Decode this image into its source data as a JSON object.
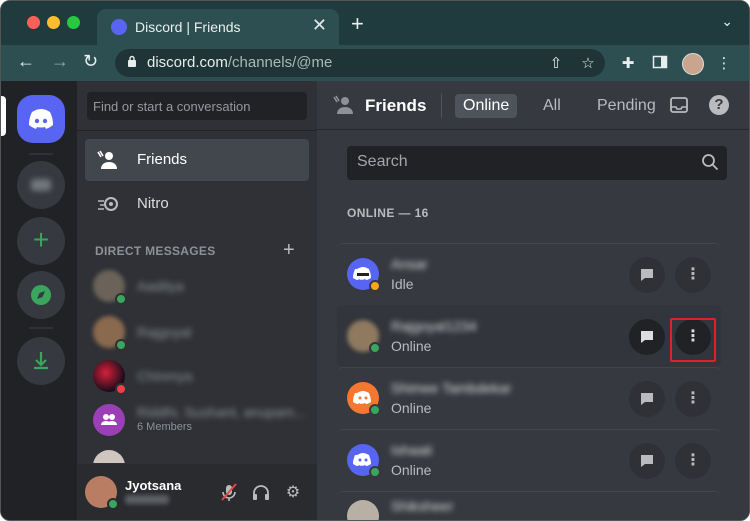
{
  "browser": {
    "tab_title": "Discord | Friends",
    "tab_close": "✕",
    "new_tab": "+",
    "url_host": "discord.com",
    "url_path": "/channels/@me",
    "menu": "⋮"
  },
  "rail": {
    "home_label": "Discord Home",
    "add_server": "+",
    "colors": {
      "accent": "#5865f2",
      "green": "#3ba55d"
    }
  },
  "sidebar": {
    "search_placeholder": "Find or start a conversation",
    "friends_label": "Friends",
    "nitro_label": "Nitro",
    "dm_header": "DIRECT MESSAGES",
    "dm_add": "+",
    "dms": [
      {
        "name": "Aaditya",
        "sub": ""
      },
      {
        "name": "Rajgoyal",
        "sub": ""
      },
      {
        "name": "Chinmya",
        "sub": ""
      },
      {
        "name": "Riddhi, Sushant, anupam...",
        "sub": "6 Members"
      },
      {
        "name": "",
        "sub": ""
      }
    ],
    "user": {
      "name": "Jyotsana"
    }
  },
  "main": {
    "title": "Friends",
    "tabs": [
      "Online",
      "All",
      "Pending"
    ],
    "search_placeholder": "Search",
    "online_header": "ONLINE — 16",
    "friends": [
      {
        "name": "Ansar",
        "status": "Idle"
      },
      {
        "name": "Rajgoyal1234",
        "status": "Online"
      },
      {
        "name": "Shimee Tambdekar",
        "status": "Online"
      },
      {
        "name": "Ishaati",
        "status": "Online"
      },
      {
        "name": "Shiksheer",
        "status": ""
      }
    ]
  }
}
